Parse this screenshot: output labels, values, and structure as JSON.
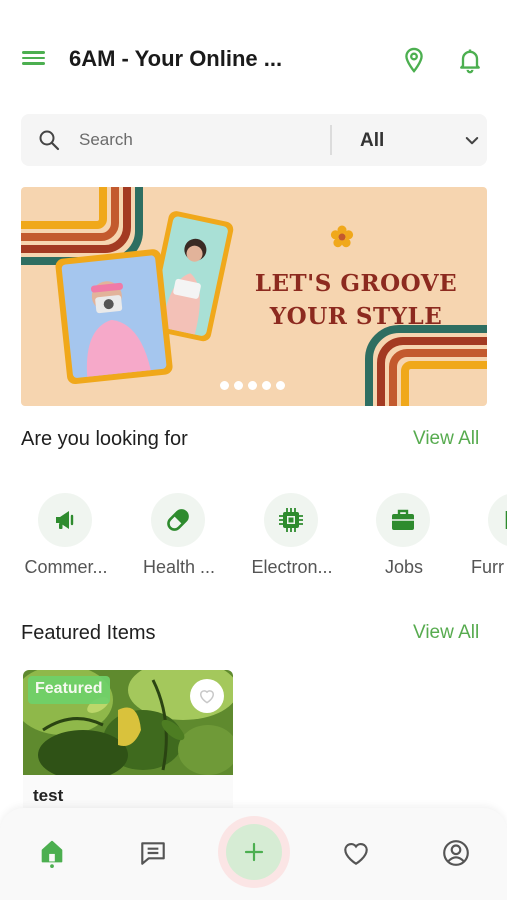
{
  "header": {
    "title": "6AM - Your Online ...",
    "menu_icon": "hamburger-menu-icon",
    "location_icon": "location-pin-icon",
    "notification_icon": "bell-icon"
  },
  "search": {
    "placeholder": "Search",
    "value": "",
    "category_selected": "All"
  },
  "banner": {
    "line1": "LET'S GROOVE",
    "line2": "YOUR STYLE",
    "slide_count": 5,
    "active_slide": 1
  },
  "categories_section": {
    "title": "Are you looking for",
    "view_all": "View All",
    "items": [
      {
        "label": "Commer...",
        "icon": "megaphone-icon"
      },
      {
        "label": "Health ...",
        "icon": "pill-icon"
      },
      {
        "label": "Electron...",
        "icon": "chip-icon"
      },
      {
        "label": "Jobs",
        "icon": "briefcase-icon"
      },
      {
        "label": "Furr",
        "icon": "furniture-icon"
      }
    ]
  },
  "featured_section": {
    "title": "Featured Items",
    "view_all": "View All",
    "items": [
      {
        "badge": "Featured",
        "title": "test",
        "favorited": false
      }
    ]
  },
  "bottom_nav": {
    "items": [
      "home-icon",
      "chat-icon",
      "add-icon",
      "heart-icon",
      "profile-icon"
    ],
    "active": "home-icon"
  },
  "colors": {
    "accent": "#4caf50",
    "view_all": "#57ab4f",
    "banner_bg": "#f6d5b0",
    "banner_text": "#8c2a1f",
    "badge": "#6fd16a"
  }
}
